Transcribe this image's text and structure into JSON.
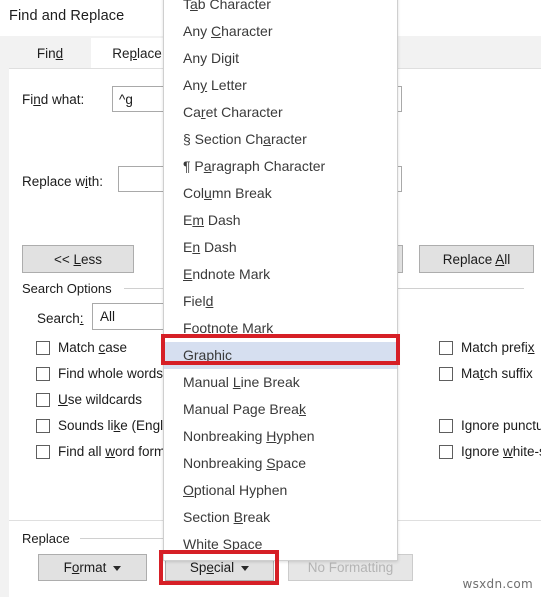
{
  "dialog": {
    "title": "Find and Replace",
    "tabs": [
      {
        "label": "Fin",
        "acc": "d",
        "tail": "",
        "active": false,
        "name": "tab-find"
      },
      {
        "label": "Re",
        "acc": "p",
        "tail": "lace",
        "active": true,
        "name": "tab-replace"
      }
    ],
    "find_what_label": "Fi",
    "find_what_label_acc": "n",
    "find_what_label_tail": "d what:",
    "find_what_value": "^g",
    "replace_with_label": "Replace w",
    "replace_with_label_acc": "i",
    "replace_with_label_tail": "th:",
    "replace_with_value": "",
    "less_button": "<< ",
    "less_button_acc": "L",
    "less_button_tail": "ess",
    "replace_all_button": "Replace ",
    "replace_all_button_acc": "A",
    "replace_all_button_tail": "ll",
    "search_options_header": "Search Options",
    "search_label": "Search",
    "search_label_acc": ":",
    "search_value": "All",
    "replace_group_header": "Replace",
    "format_button": "F",
    "format_button_acc": "o",
    "format_button_tail": "rmat",
    "special_button": "Sp",
    "special_button_acc": "e",
    "special_button_tail": "cial",
    "no_formatting_button": "No Formatting"
  },
  "checkboxes_left": [
    {
      "pre": "Match ",
      "acc": "c",
      "post": "ase",
      "checked": false,
      "name": "checkbox-match-case"
    },
    {
      "pre": "Find whole words",
      "acc": "",
      "post": "",
      "checked": false,
      "name": "checkbox-find-whole-words"
    },
    {
      "pre": "",
      "acc": "U",
      "post": "se wildcards",
      "checked": false,
      "name": "checkbox-use-wildcards"
    },
    {
      "pre": "Sounds li",
      "acc": "k",
      "post": "e (Englis",
      "checked": false,
      "name": "checkbox-sounds-like"
    },
    {
      "pre": "Find all ",
      "acc": "w",
      "post": "ord form",
      "checked": false,
      "name": "checkbox-find-all-word-forms"
    }
  ],
  "checkboxes_right": [
    {
      "pre": "Match prefi",
      "acc": "x",
      "post": "",
      "checked": false,
      "name": "checkbox-match-prefix"
    },
    {
      "pre": "Ma",
      "acc": "t",
      "post": "ch suffix",
      "checked": false,
      "name": "checkbox-match-suffix"
    },
    {
      "pre": "Ignore punctu",
      "acc": "",
      "post": "",
      "checked": false,
      "name": "checkbox-ignore-punctuation"
    },
    {
      "pre": "Ignore ",
      "acc": "w",
      "post": "hite-s",
      "checked": false,
      "name": "checkbox-ignore-white-space"
    }
  ],
  "special_menu": {
    "items": [
      {
        "pre": "T",
        "acc": "a",
        "post": "b Character",
        "selected": false
      },
      {
        "pre": "Any ",
        "acc": "C",
        "post": "haracter",
        "selected": false
      },
      {
        "pre": "Any Di",
        "acc": "g",
        "post": "it",
        "selected": false
      },
      {
        "pre": "An",
        "acc": "y",
        "post": " Letter",
        "selected": false
      },
      {
        "pre": "Ca",
        "acc": "r",
        "post": "et Character",
        "selected": false
      },
      {
        "pre": "§ Section Ch",
        "acc": "a",
        "post": "racter",
        "selected": false
      },
      {
        "pre": "¶ P",
        "acc": "a",
        "post": "ragraph Character",
        "selected": false
      },
      {
        "pre": "Col",
        "acc": "u",
        "post": "mn Break",
        "selected": false
      },
      {
        "pre": "E",
        "acc": "m",
        "post": " Dash",
        "selected": false
      },
      {
        "pre": "E",
        "acc": "n",
        "post": " Dash",
        "selected": false
      },
      {
        "pre": "",
        "acc": "E",
        "post": "ndnote Mark",
        "selected": false
      },
      {
        "pre": "Fiel",
        "acc": "d",
        "post": "",
        "selected": false
      },
      {
        "pre": "",
        "acc": "F",
        "post": "ootnote Mark",
        "selected": false
      },
      {
        "pre": "Graph",
        "acc": "i",
        "post": "c",
        "selected": true
      },
      {
        "pre": "Manual ",
        "acc": "L",
        "post": "ine Break",
        "selected": false
      },
      {
        "pre": "Manual Page Brea",
        "acc": "k",
        "post": "",
        "selected": false
      },
      {
        "pre": "Nonbreaking ",
        "acc": "H",
        "post": "yphen",
        "selected": false
      },
      {
        "pre": "Nonbreaking ",
        "acc": "S",
        "post": "pace",
        "selected": false
      },
      {
        "pre": "",
        "acc": "O",
        "post": "ptional Hyphen",
        "selected": false
      },
      {
        "pre": "Section ",
        "acc": "B",
        "post": "reak",
        "selected": false
      },
      {
        "pre": "",
        "acc": "W",
        "post": "hite Space",
        "selected": false
      }
    ]
  },
  "annotations": {
    "accent_color": "#d61f26",
    "highlight_color": "#d6dff0"
  },
  "watermark": "wsxdn.com"
}
